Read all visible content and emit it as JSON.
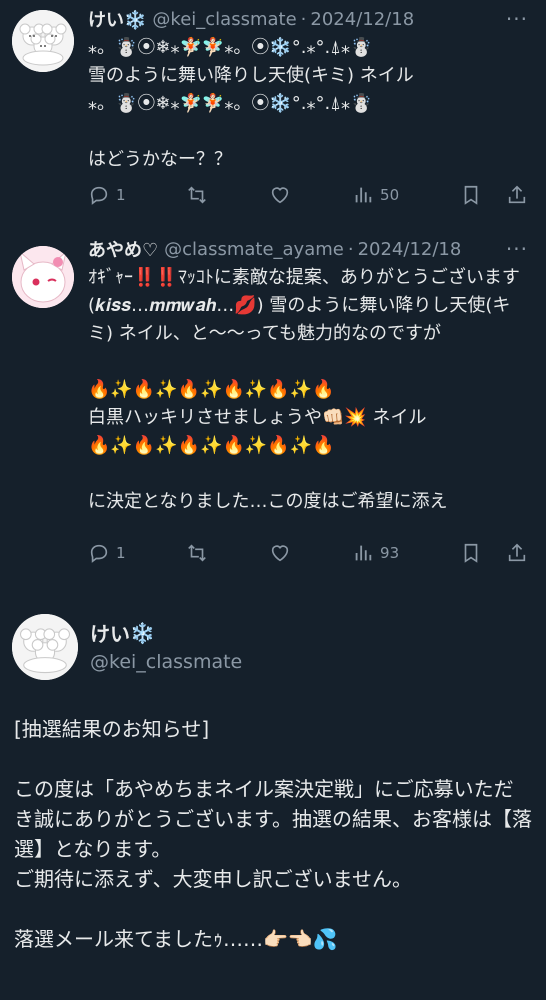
{
  "tweets": [
    {
      "name": "けい",
      "name_emoji": "❄️",
      "handle": "@kei_classmate",
      "date": "2024/12/18",
      "more": "···",
      "body": "⁎。☃️⦿❄⁎🧚🏻🧚🏻⁎。⦿❄️°.⁎°.⍋⁎☃️\n雪のように舞い降りし天使(キミ) ネイル\n⁎。☃️⦿❄⁎🧚🏻🧚🏻⁎。⦿❄️°.⁎°.⍋⁎☃️\n\nはどうかなー？？",
      "replies": "1",
      "views": "50"
    },
    {
      "name": "あやめ♡",
      "handle": "@classmate_ayame",
      "date": "2024/12/18",
      "more": "···",
      "body": "ｵｷﾞｬｰ‼️‼️ﾏｯｺﾄに素敵な提案、ありがとうございます(𝒌𝒊𝒔𝒔…𝒎𝒎𝒘𝒂𝒉…💋) 雪のように舞い降りし天使(キミ) ネイル、と〜〜っても魅力的なのですが\n\n🔥✨🔥✨🔥✨🔥✨🔥✨🔥\n白黒ハッキリさせましょうや👊🏻💥 ネイル\n🔥✨🔥✨🔥✨🔥✨🔥✨🔥\n\nに決定となりました…この度はご希望に添え",
      "replies": "1",
      "views": "93"
    }
  ],
  "main": {
    "name": "けい",
    "name_emoji": "❄️",
    "handle": "@kei_classmate",
    "body": "[抽選結果のお知らせ]\n\nこの度は「あやめちまネイル案決定戦」にご応募いただき誠にありがとうございます。抽選の結果、お客様は【落選】となります。\nご期待に添えず、大変申し訳ございません。\n\n落選メール来てましたｩ……👉🏻👈🏻💦"
  }
}
